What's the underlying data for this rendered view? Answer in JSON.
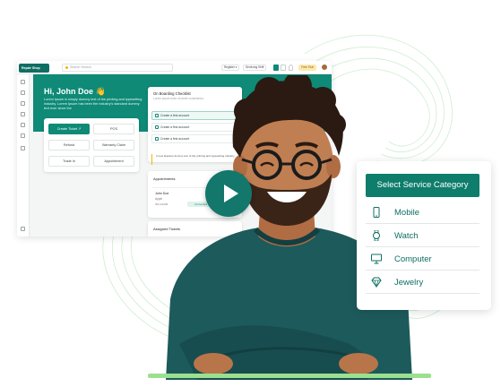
{
  "dashboard": {
    "brand": "Repair Shop",
    "search_placeholder": "Search Search",
    "top_pills": [
      "Register ▾",
      "Servicing Shift"
    ],
    "trial_badge": "Free Trial",
    "greeting": "Hi, John Doe 👋",
    "greeting_sub": "Lorem Ipsum is simply dummy text of the printing and typesetting industry. Lorem Ipsum has been the industry's standard dummy text ever since the",
    "quick_actions": [
      "Create Ticket ↗",
      "POS",
      "Refund",
      "Warranty Claim",
      "Trade In",
      "Appointment"
    ],
    "checklist": {
      "title": "On Boarding Checklist",
      "subtitle": "Lorem ipsum dolor sit amet consectetur.",
      "items": [
        "Create a first account",
        "Create a first account",
        "Create a first account"
      ],
      "note": "2 new features dummy text of the printing and typesetting industry."
    },
    "appointments": {
      "title": "Appointments",
      "name": "John Doe",
      "device": "Apple",
      "id": "INV-12345",
      "status": "Converted"
    },
    "assigned_title": "Assigned Tickets"
  },
  "service_card": {
    "button": "Select Service Category",
    "items": [
      {
        "label": "Mobile",
        "icon": "mobile-icon"
      },
      {
        "label": "Watch",
        "icon": "watch-icon"
      },
      {
        "label": "Computer",
        "icon": "computer-icon"
      },
      {
        "label": "Jewelry",
        "icon": "diamond-icon"
      }
    ]
  },
  "colors": {
    "primary": "#0e7d6c",
    "accent_green": "#9be08f",
    "play": "#13776b"
  }
}
